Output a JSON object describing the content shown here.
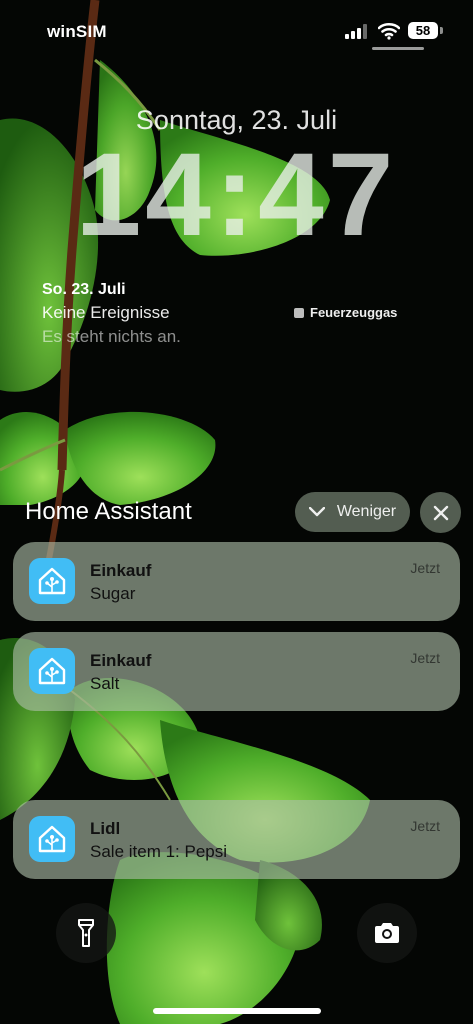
{
  "status_bar": {
    "carrier": "winSIM",
    "battery_level": "58",
    "signal_icon": "cellular-signal-icon",
    "wifi_icon": "wifi-icon"
  },
  "lock_screen": {
    "date": "Sonntag, 23. Juli",
    "time": "14:47"
  },
  "widgets": {
    "calendar": {
      "date": "So. 23. Juli",
      "events": "Keine Ereignisse",
      "empty_text": "Es steht nichts an."
    },
    "reminder": {
      "label": "Feuerzeuggas"
    }
  },
  "notification_group": {
    "app_name": "Home Assistant",
    "less_label": "Weniger",
    "icons": {
      "less": "chevron-down-icon",
      "close": "close-icon",
      "app": "home-assistant-icon"
    },
    "accent_color": "#41bdf5",
    "items": [
      {
        "title": "Einkauf",
        "body": "Sugar",
        "time": "Jetzt"
      },
      {
        "title": "Einkauf",
        "body": "Salt",
        "time": "Jetzt"
      },
      {
        "title": "Lidl",
        "body": "Sale item 1: Pepsi",
        "time": "Jetzt"
      }
    ]
  },
  "bottom_controls": {
    "flashlight_icon": "flashlight-icon",
    "camera_icon": "camera-icon"
  }
}
